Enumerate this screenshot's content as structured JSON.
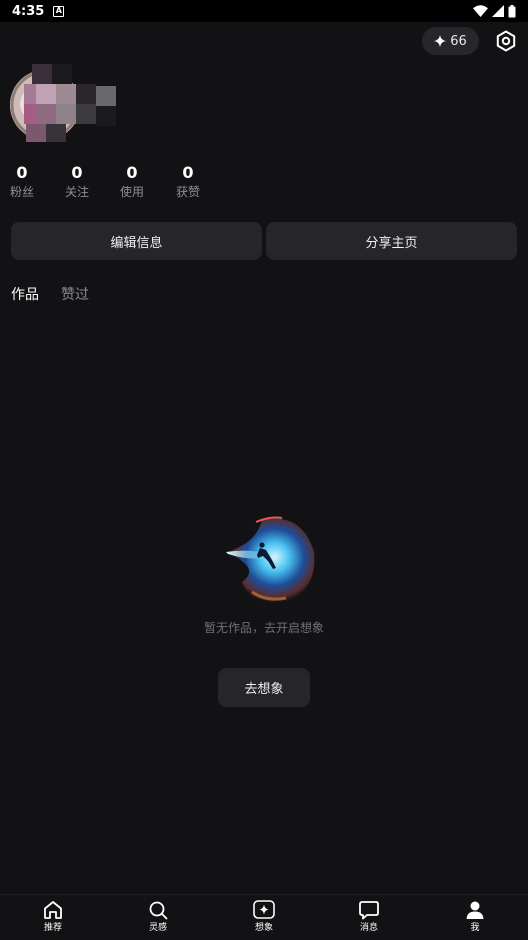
{
  "status_bar": {
    "time": "4:35"
  },
  "header": {
    "credits": "66"
  },
  "stats": [
    {
      "value": "0",
      "label": "粉丝"
    },
    {
      "value": "0",
      "label": "关注"
    },
    {
      "value": "0",
      "label": "使用"
    },
    {
      "value": "0",
      "label": "获赞"
    }
  ],
  "actions": {
    "edit_label": "编辑信息",
    "share_label": "分享主页"
  },
  "tabs": [
    {
      "label": "作品",
      "active": true
    },
    {
      "label": "赞过",
      "active": false
    }
  ],
  "empty_state": {
    "message": "暂无作品，去开启想象",
    "button_label": "去想象"
  },
  "bottom_nav": [
    {
      "label": "推荐",
      "icon": "home-icon"
    },
    {
      "label": "灵感",
      "icon": "search-icon"
    },
    {
      "label": "想象",
      "icon": "sparkle-icon"
    },
    {
      "label": "消息",
      "icon": "message-icon"
    },
    {
      "label": "我",
      "icon": "profile-icon"
    }
  ],
  "colors": {
    "background": "#121214",
    "surface": "#25252a",
    "muted": "#8a8a90"
  }
}
